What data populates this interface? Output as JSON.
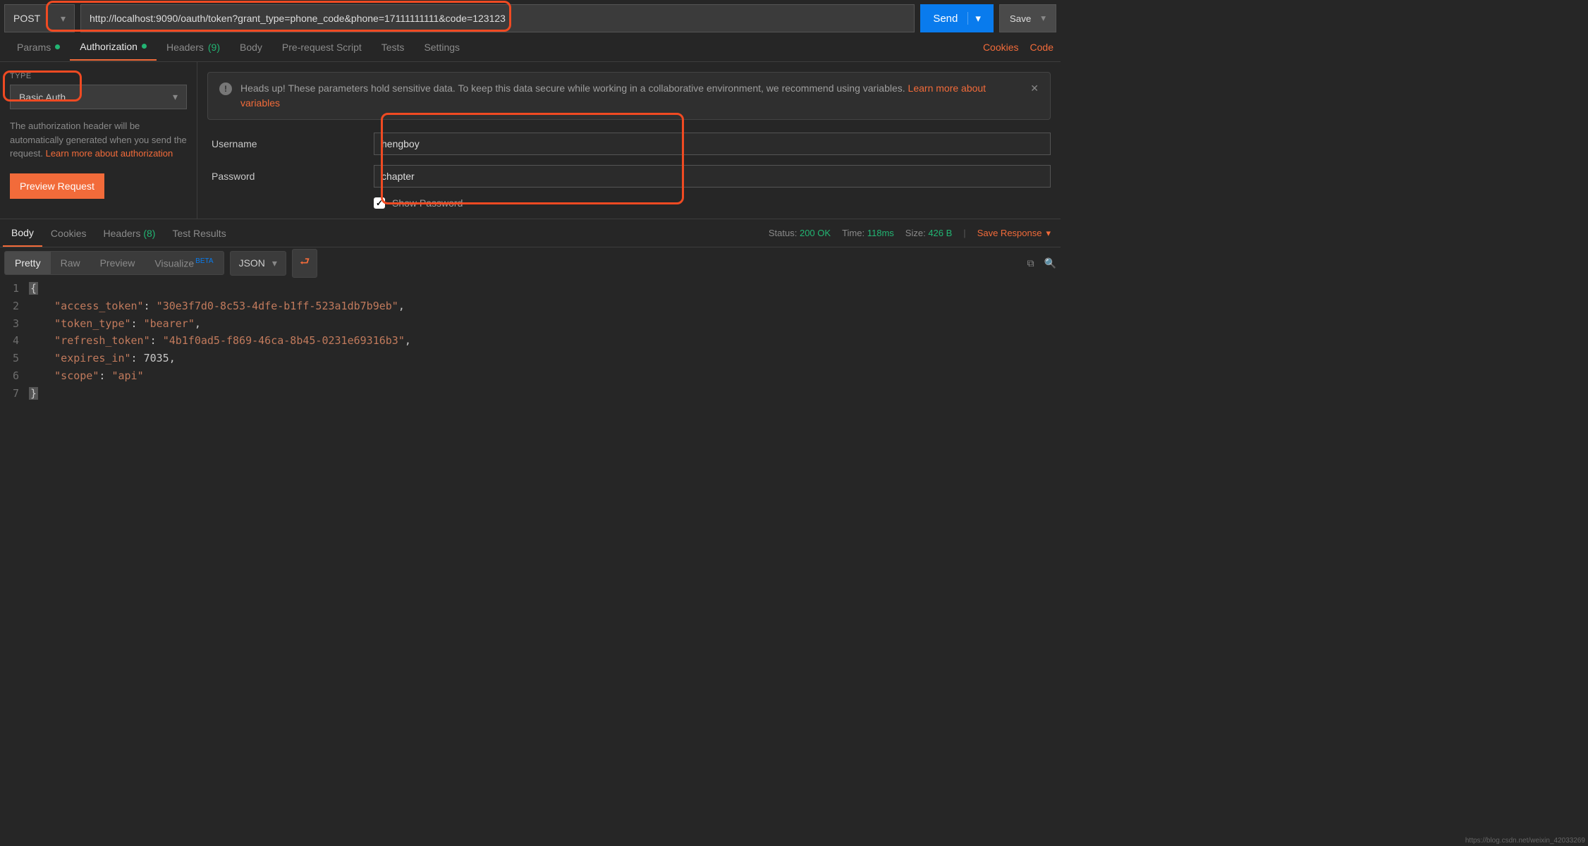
{
  "request": {
    "method": "POST",
    "url": "http://localhost:9090/oauth/token?grant_type=phone_code&phone=17111111111&code=123123",
    "send_label": "Send",
    "save_label": "Save"
  },
  "req_tabs": {
    "params": "Params",
    "authorization": "Authorization",
    "headers_label": "Headers",
    "headers_count": "(9)",
    "body": "Body",
    "prerequest": "Pre-request Script",
    "tests": "Tests",
    "settings": "Settings",
    "cookies_link": "Cookies",
    "code_link": "Code"
  },
  "auth": {
    "type_label": "TYPE",
    "type_value": "Basic Auth",
    "desc_prefix": "The authorization header will be automatically generated when you send the request. ",
    "learn_more": "Learn more about authorization",
    "preview_btn": "Preview Request",
    "banner_text": "Heads up! These parameters hold sensitive data. To keep this data secure while working in a collaborative environment, we recommend using variables. ",
    "banner_link": "Learn more about variables",
    "username_label": "Username",
    "username_value": "hengboy",
    "password_label": "Password",
    "password_value": "chapter",
    "show_password": "Show Password"
  },
  "response": {
    "tabs": {
      "body": "Body",
      "cookies": "Cookies",
      "headers_label": "Headers",
      "headers_count": "(8)",
      "test_results": "Test Results"
    },
    "status_label": "Status:",
    "status_value": "200 OK",
    "time_label": "Time:",
    "time_value": "118ms",
    "size_label": "Size:",
    "size_value": "426 B",
    "save_response": "Save Response",
    "views": {
      "pretty": "Pretty",
      "raw": "Raw",
      "preview": "Preview",
      "visualize": "Visualize",
      "beta": "BETA",
      "format": "JSON"
    },
    "json": {
      "access_token": "30e3f7d0-8c53-4dfe-b1ff-523a1db7b9eb",
      "token_type": "bearer",
      "refresh_token": "4b1f0ad5-f869-46ca-8b45-0231e69316b3",
      "expires_in": 7035,
      "scope": "api"
    }
  },
  "watermark": "https://blog.csdn.net/weixin_42033269"
}
